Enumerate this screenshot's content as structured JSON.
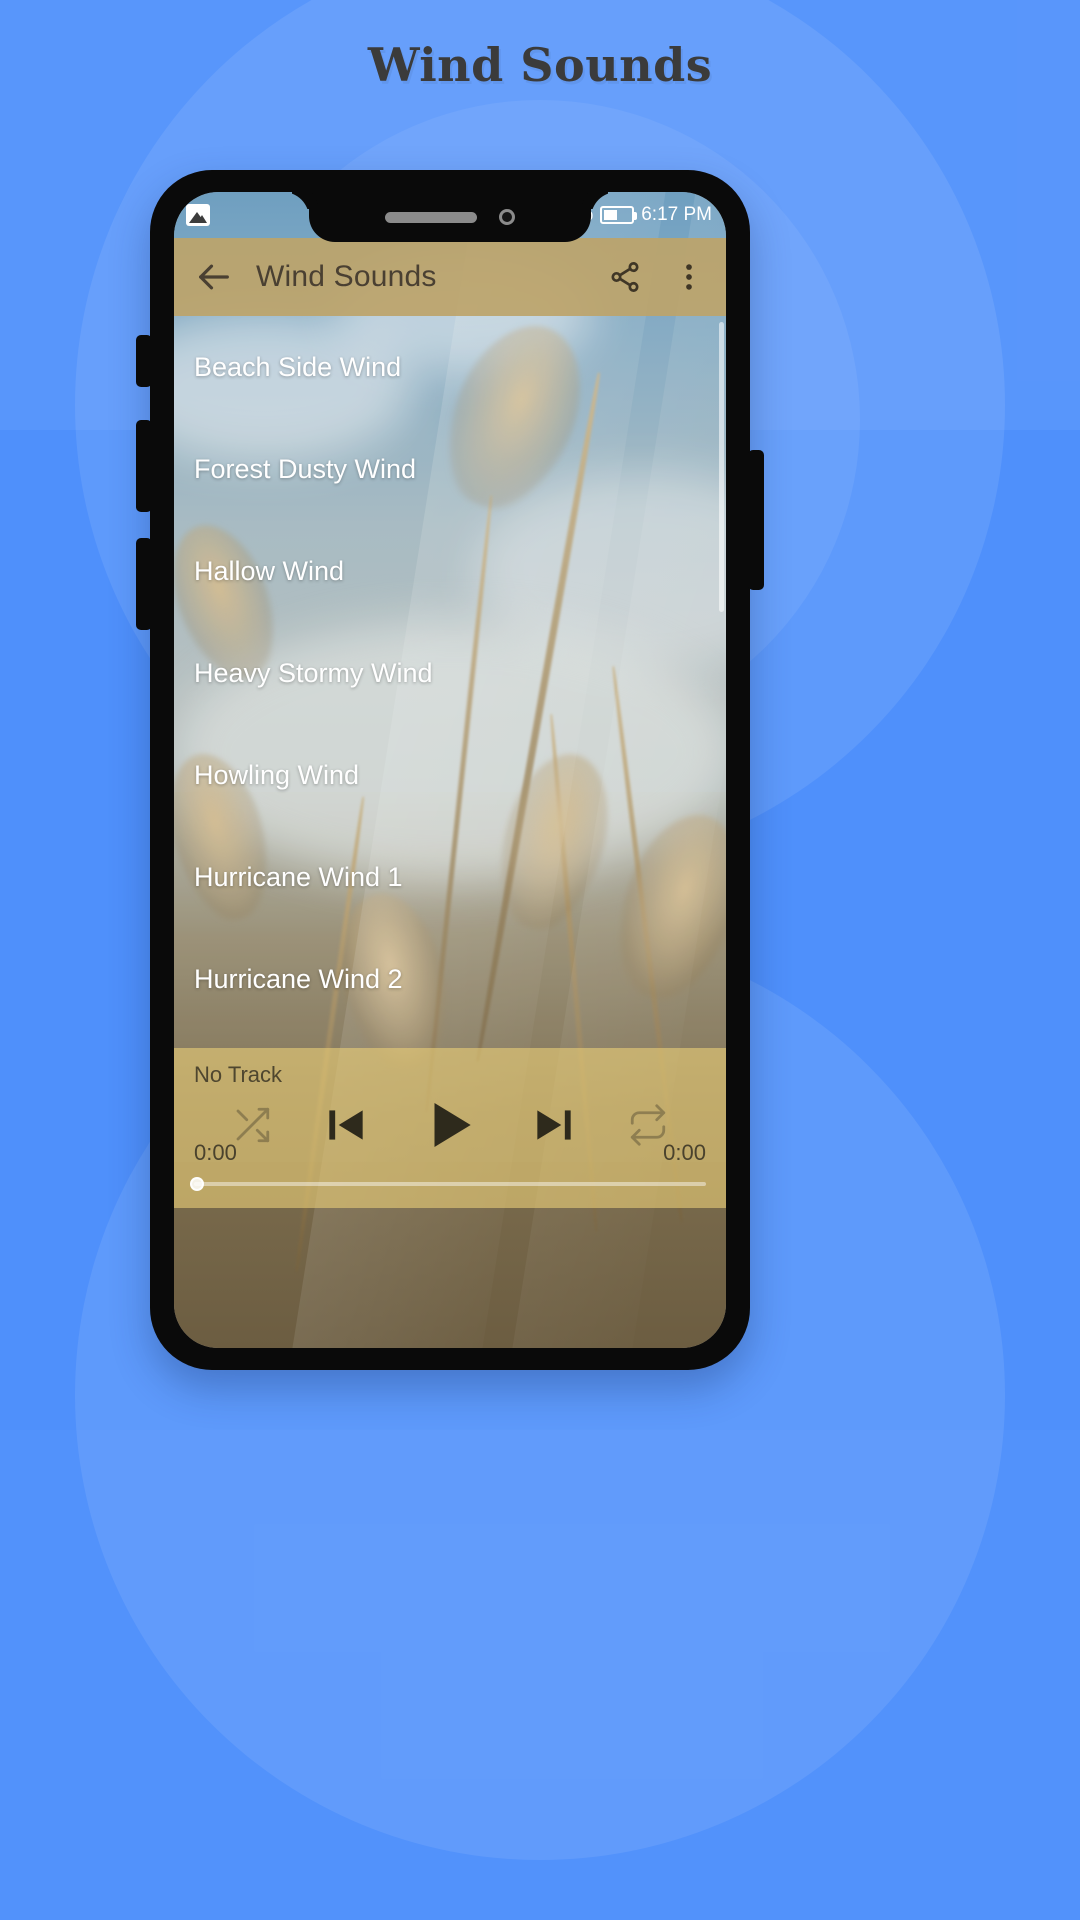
{
  "page": {
    "title": "Wind Sounds",
    "background_color": "#4f90fb"
  },
  "phone": {
    "notch": {
      "speaker": "speaker-grille",
      "camera": "front-camera"
    },
    "status_bar": {
      "left_icon": "gallery-icon",
      "percent_symbol": "%",
      "battery_icon": "battery-icon",
      "time": "6:17 PM"
    }
  },
  "app": {
    "toolbar": {
      "back_icon": "arrow-back-icon",
      "title": "Wind Sounds",
      "share_icon": "share-icon",
      "overflow_icon": "more-vert-icon",
      "background_color": "#bca46a",
      "text_color": "#4a4032"
    },
    "track_list": [
      {
        "name": "Beach Side Wind"
      },
      {
        "name": "Forest Dusty Wind"
      },
      {
        "name": "Hallow Wind"
      },
      {
        "name": "Heavy Stormy Wind"
      },
      {
        "name": "Howling Wind"
      },
      {
        "name": "Hurricane Wind 1"
      },
      {
        "name": "Hurricane Wind 2"
      }
    ],
    "player": {
      "now_playing": "No Track",
      "shuffle_icon": "shuffle-icon",
      "previous_icon": "skip-previous-icon",
      "play_icon": "play-icon",
      "next_icon": "skip-next-icon",
      "repeat_icon": "repeat-icon",
      "elapsed_time": "0:00",
      "total_time": "0:00",
      "progress_percent": 0,
      "panel_color": "#e8cd78"
    }
  }
}
